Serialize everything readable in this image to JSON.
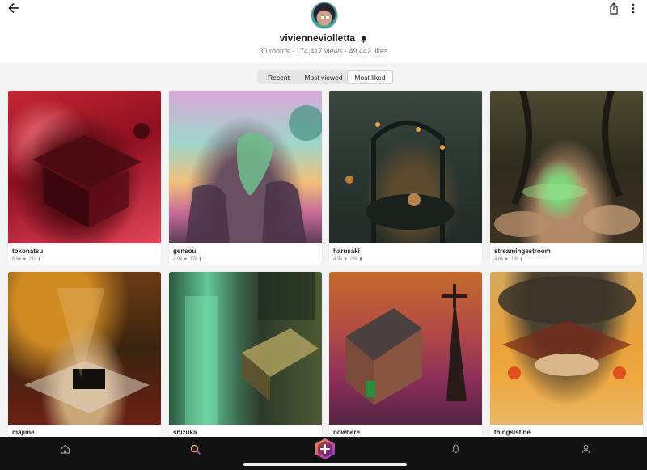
{
  "profile": {
    "username": "vivienneviolletta",
    "stats": "30 rooms · 174,417 views · 49,442 likes"
  },
  "sort_tabs": [
    "Recent",
    "Most viewed",
    "Most liked"
  ],
  "selected_tab": "Most liked",
  "rooms": [
    {
      "name": "tokonatsu",
      "likes": "8.6k",
      "views": "21k"
    },
    {
      "name": "gensou",
      "likes": "4.9k",
      "views": "17k"
    },
    {
      "name": "harusaki",
      "likes": "4.9k",
      "views": "23k"
    },
    {
      "name": "streamingestroom",
      "likes": "4.6k",
      "views": "18k"
    },
    {
      "name": "majime"
    },
    {
      "name": "shizuka"
    },
    {
      "name": "nowhere"
    },
    {
      "name": "thingsisfine"
    }
  ],
  "bottom_nav": [
    "home-icon",
    "search-icon",
    "create-icon",
    "notifications-icon",
    "profile-icon"
  ],
  "colors": {
    "search_accent": "#e0a24a",
    "create_accent": "#c13ee0",
    "nav_bg": "#121212"
  }
}
